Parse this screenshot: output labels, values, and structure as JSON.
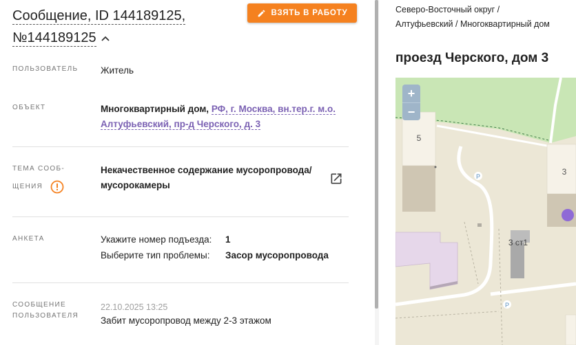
{
  "message": {
    "title_line1": "Сообщение, ID 144189125,",
    "title_line2": "№144189125",
    "take_button": "ВЗЯТЬ В РАБОТУ"
  },
  "fields": {
    "user_label": "ПОЛЬЗОВАТЕЛЬ",
    "user_value": "Житель",
    "object_label": "ОБЪЕКТ",
    "object_type": "Многоквартирный дом,",
    "object_link_line1": "РФ, г. Москва, вн.тер.г. м.о.",
    "object_link_line2": "Алтуфьевский, пр-д Черского, д. 3",
    "topic_label_line1": "ТЕМА СООБ-",
    "topic_label_line2": "ЩЕНИЯ",
    "topic_line1": "Некачественное содержание мусоропровода/",
    "topic_line2": "мусорокамеры",
    "anketa_label": "АНКЕТА",
    "anketa": [
      {
        "question": "Укажите номер подъезда:",
        "answer": "1"
      },
      {
        "question": "Выберите тип проблемы:",
        "answer": "Засор мусоропровода"
      }
    ],
    "msg_label_line1": "СООБЩЕНИЕ",
    "msg_label_line2": "ПОЛЬЗОВАТЕЛЯ",
    "msg_date": "22.10.2025 13:25",
    "msg_text": "Забит мусоропровод между 2-3 этажом"
  },
  "location": {
    "breadcrumb_line1": "Северо-Восточный округ /",
    "breadcrumb_line2": "Алтуфьевский / Многоквартирный дом",
    "address": "проезд Черского, дом 3"
  },
  "map": {
    "zoom_in": "+",
    "zoom_out": "−",
    "building_5": "5",
    "building_3": "3",
    "building_3st1": "3 ст1",
    "parking_1": "P",
    "parking_2": "P"
  },
  "colors": {
    "accent": "#f5811f",
    "link": "#7b61b3",
    "marker": "#8f6ad6"
  }
}
